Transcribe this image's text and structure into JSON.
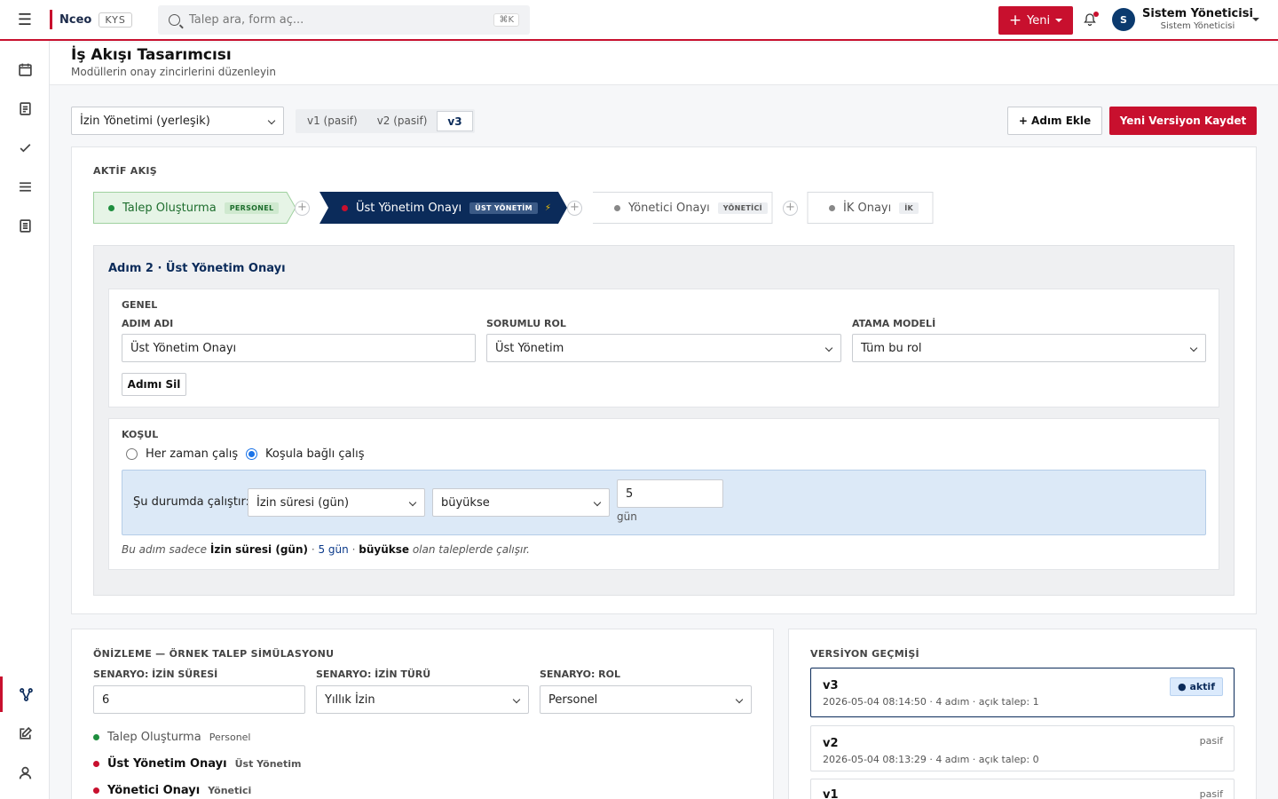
{
  "topbar": {
    "brand": "Nceo",
    "brand_tag": "KYS",
    "search_placeholder": "Talep ara, form aç...",
    "search_shortcut": "⌘K",
    "new_button": "Yeni",
    "user_name": "Sistem Yöneticisi",
    "user_role": "Sistem Yöneticisi",
    "avatar_initial": "S"
  },
  "page": {
    "title": "İş Akışı Tasarımcısı",
    "subtitle": "Modüllerin onay zincirlerini düzenleyin"
  },
  "toolbar": {
    "module_select": "İzin Yönetimi (yerleşik)",
    "versions": [
      "v1 (pasif)",
      "v2 (pasif)",
      "v3"
    ],
    "active_version": "v3",
    "add_step": "+ Adım Ekle",
    "save_version": "Yeni Versiyon Kaydet"
  },
  "flow": {
    "label": "AKTİF AKIŞ",
    "steps": [
      {
        "name": "Talep Oluşturma",
        "role": "PERSONEL"
      },
      {
        "name": "Üst Yönetim Onayı",
        "role": "ÜST YÖNETİM",
        "flag": "⚡"
      },
      {
        "name": "Yönetici Onayı",
        "role": "YÖNETİCİ"
      },
      {
        "name": "İK Onayı",
        "role": "İK"
      }
    ]
  },
  "step_detail": {
    "title": "Adım 2 · Üst Yönetim Onayı",
    "general": {
      "label": "GENEL",
      "name_label": "ADIM ADI",
      "name_value": "Üst Yönetim Onayı",
      "role_label": "SORUMLU ROL",
      "role_value": "Üst Yönetim",
      "assign_label": "ATAMA MODELİ",
      "assign_value": "Tüm bu rol",
      "delete_button": "Adımı Sil"
    },
    "condition": {
      "label": "KOŞUL",
      "opt_always": "Her zaman çalış",
      "opt_conditional": "Koşula bağlı çalış",
      "run_when": "Şu durumda çalıştır:",
      "field": "İzin süresi (gün)",
      "operator": "büyükse",
      "value": "5",
      "unit": "gün",
      "summary_pre": "Bu adım sadece",
      "summary_field": "İzin süresi (gün)",
      "summary_value": "5 gün",
      "summary_op": "büyükse",
      "summary_post": "olan taleplerde çalışır."
    }
  },
  "simulation": {
    "label": "ÖNİZLEME — ÖRNEK TALEP SİMÜLASYONU",
    "duration_label": "SENARYO: İZİN SÜRESİ",
    "duration_value": "6",
    "type_label": "SENARYO: İZİN TÜRÜ",
    "type_value": "Yıllık İzin",
    "role_label": "SENARYO: ROL",
    "role_value": "Personel",
    "steps": [
      {
        "name": "Talep Oluşturma",
        "role": "Personel"
      },
      {
        "name": "Üst Yönetim Onayı",
        "role": "Üst Yönetim"
      },
      {
        "name": "Yönetici Onayı",
        "role": "Yönetici"
      }
    ]
  },
  "history": {
    "label": "VERSİYON GEÇMİŞİ",
    "versions": [
      {
        "name": "v3",
        "meta": "2026-05-04 08:14:50 · 4 adım · açık talep: 1",
        "status": "aktif"
      },
      {
        "name": "v2",
        "meta": "2026-05-04 08:13:29 · 4 adım · açık talep: 0",
        "status": "pasif"
      },
      {
        "name": "v1",
        "meta": "",
        "status": "pasif"
      }
    ]
  },
  "colors": {
    "accent": "#c8102e",
    "navy": "#0b2b5a",
    "green": "#1e8e3e"
  }
}
